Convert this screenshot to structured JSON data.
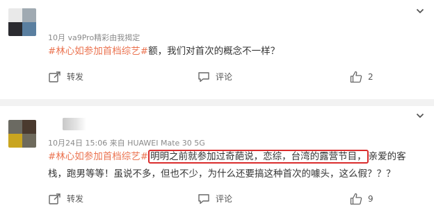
{
  "posts": [
    {
      "meta_text": "10月      va9Pro精彩由我揭定",
      "topic": "#林心如参加首档综艺#",
      "text": "额，我们对首次的概念不一样？",
      "repost_label": "转发",
      "comment_label": "评论",
      "like_count": "2",
      "avatar_colors": [
        "#e9e9e9",
        "#a0aab2",
        "#2b2b30",
        "#5a7fa0"
      ]
    },
    {
      "meta_text": "10月24日 15:06  来自 HUAWEI Mate 30 5G",
      "topic": "#林心如参加首档综艺#",
      "highlight": "明明之前就参加过奇葩说，恋综，台湾的露营节目，",
      "text_rest": "亲爱的客栈，跑男等等！虽说不多，但也不少，为什么还要搞这种首次的噱头，这么假？？？",
      "repost_label": "转发",
      "comment_label": "评论",
      "like_count": "9",
      "avatar_colors": [
        "#6b6a62",
        "#4a3a2e",
        "#c9a520",
        "#6e6a5c"
      ]
    }
  ],
  "colors": {
    "topic": "#eb7350",
    "highlight_border": "#d92c2c",
    "divider": "#f2f2f2"
  },
  "icons": [
    "chevron-down-icon",
    "repost-icon",
    "comment-icon",
    "like-icon"
  ]
}
